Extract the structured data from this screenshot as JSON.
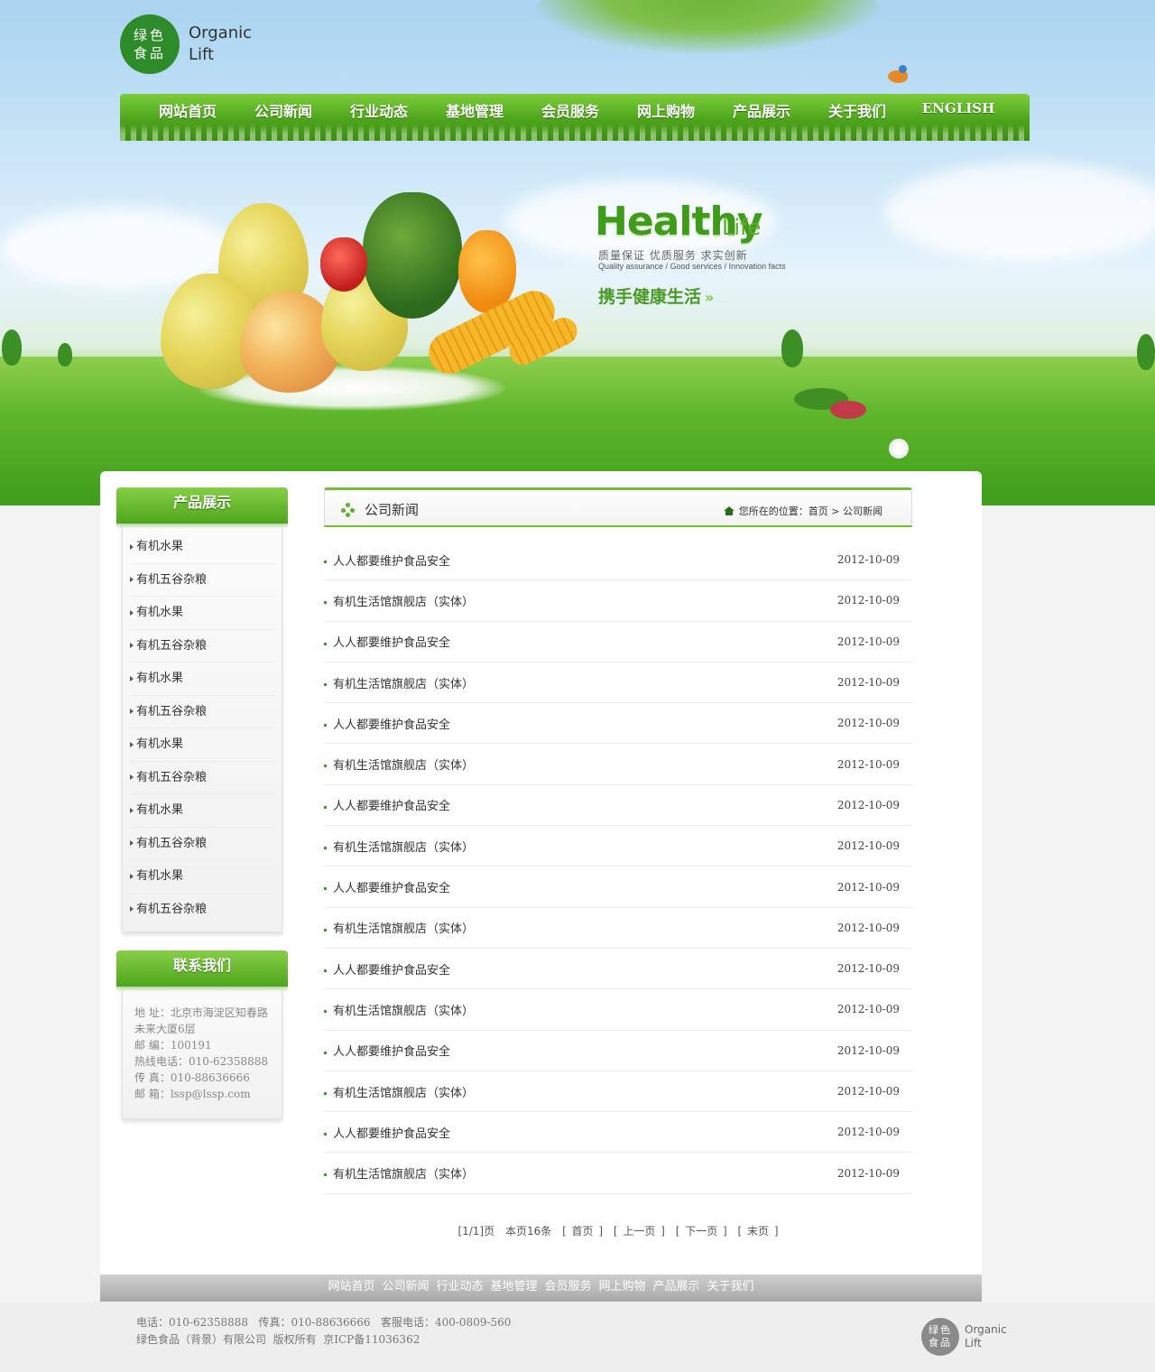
{
  "brand": {
    "logo_cn_line1": "绿色",
    "logo_cn_line2": "食品",
    "logo_en_line1": "Organic",
    "logo_en_line2": "Lift",
    "color_primary": "#4ea51c",
    "color_accent": "#6fbf35"
  },
  "nav": {
    "items": [
      "网站首页",
      "公司新闻",
      "行业动态",
      "基地管理",
      "会员服务",
      "网上购物",
      "产品展示",
      "关于我们"
    ],
    "english": "ENGLISH"
  },
  "banner": {
    "headline_big": "Healthy",
    "headline_small": "Life",
    "slogan_cn": "质量保证 优质服务 求实创新",
    "slogan_en": "Quality assurance / Good services / Innovation facts",
    "slogan_main": "携手健康生活",
    "arrow": "»"
  },
  "sidebar": {
    "products_title": "产品展示",
    "products": [
      "有机水果",
      "有机五谷杂粮",
      "有机水果",
      "有机五谷杂粮",
      "有机水果",
      "有机五谷杂粮",
      "有机水果",
      "有机五谷杂粮",
      "有机水果",
      "有机五谷杂粮",
      "有机水果",
      "有机五谷杂粮"
    ],
    "contact_title": "联系我们",
    "contact": {
      "address": "地 址：北京市海淀区知春路未来大厦6层",
      "postcode": "邮 编：100191",
      "hotline": "热线电话：010-62358888",
      "fax": "传 真：010-88636666",
      "email": "邮 箱：lssp@lssp.com"
    }
  },
  "main": {
    "section_title": "公司新闻",
    "location_label": "您所在的位置：",
    "location_home": "首页",
    "location_sep": " > ",
    "location_current": "公司新闻",
    "news": [
      {
        "title": "人人都要维护食品安全",
        "date": "2012-10-09"
      },
      {
        "title": "有机生活馆旗舰店（实体）",
        "date": "2012-10-09"
      },
      {
        "title": "人人都要维护食品安全",
        "date": "2012-10-09"
      },
      {
        "title": "有机生活馆旗舰店（实体）",
        "date": "2012-10-09"
      },
      {
        "title": "人人都要维护食品安全",
        "date": "2012-10-09"
      },
      {
        "title": "有机生活馆旗舰店（实体）",
        "date": "2012-10-09"
      },
      {
        "title": "人人都要维护食品安全",
        "date": "2012-10-09"
      },
      {
        "title": "有机生活馆旗舰店（实体）",
        "date": "2012-10-09"
      },
      {
        "title": "人人都要维护食品安全",
        "date": "2012-10-09"
      },
      {
        "title": "有机生活馆旗舰店（实体）",
        "date": "2012-10-09"
      },
      {
        "title": "人人都要维护食品安全",
        "date": "2012-10-09"
      },
      {
        "title": "有机生活馆旗舰店（实体）",
        "date": "2012-10-09"
      },
      {
        "title": "人人都要维护食品安全",
        "date": "2012-10-09"
      },
      {
        "title": "有机生活馆旗舰店（实体）",
        "date": "2012-10-09"
      },
      {
        "title": "人人都要维护食品安全",
        "date": "2012-10-09"
      },
      {
        "title": "有机生活馆旗舰店（实体）",
        "date": "2012-10-09"
      }
    ],
    "pager": {
      "page_info": "[1/1]页",
      "count_info": "本页16条",
      "first": "[ 首页 ]",
      "prev": "[ 上一页 ]",
      "next": "[ 下一页 ]",
      "last": "[ 末页 ]"
    }
  },
  "footer": {
    "nav": [
      "网站首页",
      "公司新闻",
      "行业动态",
      "基地管理",
      "会员服务",
      "网上购物",
      "产品展示",
      "关于我们"
    ],
    "line1": "电话：010-62358888   传真：010-88636666   客服电话：400-0809-560",
    "line2": "绿色食品（背景）有限公司  版权所有  京ICP备11036362",
    "logo_cn_line1": "绿色",
    "logo_cn_line2": "食品",
    "logo_en_line1": "Organic",
    "logo_en_line2": "Lift"
  }
}
